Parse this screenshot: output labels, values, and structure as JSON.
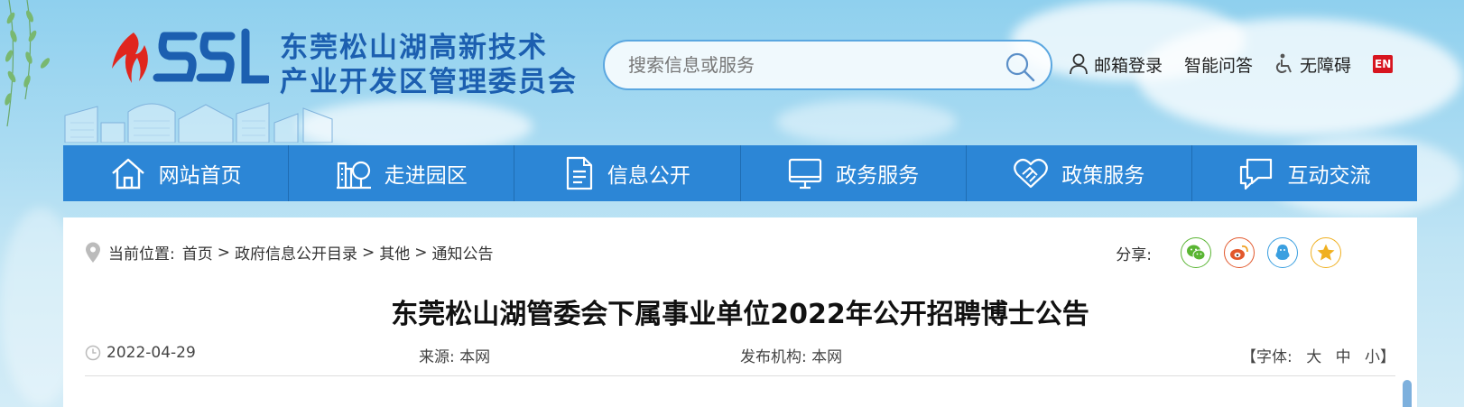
{
  "header": {
    "title_line1": "东莞松山湖高新技术",
    "title_line2": "产业开发区管理委员会",
    "search_placeholder": "搜索信息或服务",
    "tools": {
      "mail_login": "邮箱登录",
      "smart_qa": "智能问答",
      "accessibility": "无障碍",
      "english": "EN"
    }
  },
  "nav": {
    "items": [
      {
        "label": "网站首页",
        "icon": "home-icon"
      },
      {
        "label": "走进园区",
        "icon": "park-icon"
      },
      {
        "label": "信息公开",
        "icon": "document-icon"
      },
      {
        "label": "政务服务",
        "icon": "monitor-icon"
      },
      {
        "label": "政策服务",
        "icon": "handshake-heart-icon"
      },
      {
        "label": "互动交流",
        "icon": "chat-icon"
      }
    ]
  },
  "breadcrumb": {
    "prefix": "当前位置:",
    "items": [
      "首页",
      "政府信息公开目录",
      "其他",
      "通知公告"
    ],
    "separator": ">"
  },
  "share": {
    "label": "分享:",
    "buttons": [
      {
        "name": "wechat-icon",
        "color": "#5ab533"
      },
      {
        "name": "weibo-icon",
        "color": "#e2582c"
      },
      {
        "name": "qq-icon",
        "color": "#3a9fe0"
      },
      {
        "name": "qzone-icon",
        "color": "#f0b020"
      }
    ]
  },
  "article": {
    "title": "东莞松山湖管委会下属事业单位2022年公开招聘博士公告",
    "date": "2022-04-29",
    "source_label": "来源:",
    "source_value": "本网",
    "org_label": "发布机构:",
    "org_value": "本网",
    "font_label": "【字体:",
    "font_large": "大",
    "font_medium": "中",
    "font_small": "小】"
  },
  "colors": {
    "nav_bg": "#2c86d6",
    "title_blue": "#1c5fb0",
    "logo_red": "#e0261e"
  }
}
